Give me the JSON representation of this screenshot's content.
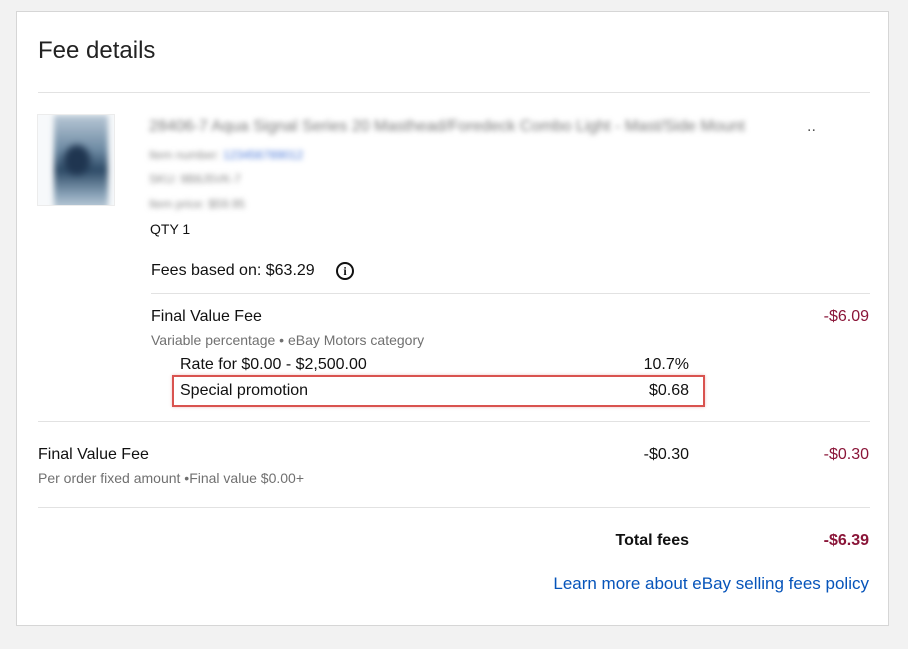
{
  "header": {
    "title": "Fee details"
  },
  "item": {
    "title_blurred": "28406-7 Aqua Signal Series 20 Masthead/Foredeck Combo Light - Mast/Side Mount",
    "ellipsis": "..",
    "item_number_label": "Item number:",
    "item_number_value": "123456789012",
    "sku_label": "SKU: 9B8J5VK-7",
    "price_label": "Item price: $59.95",
    "qty": "QTY 1"
  },
  "fees_based": {
    "text": "Fees based on: $63.29",
    "info_icon": "info-icon"
  },
  "final_value_fee_1": {
    "label": "Final Value Fee",
    "sub": "Variable percentage  •  eBay Motors category",
    "amount": "-$6.09",
    "rate_label": "Rate for $0.00 - $2,500.00",
    "rate_value": "10.7%",
    "promo_label": "Special promotion",
    "promo_value": "$0.68"
  },
  "final_value_fee_2": {
    "label": "Final Value Fee",
    "sub": "Per order fixed amount  •Final value $0.00+",
    "middle": "-$0.30",
    "amount": "-$0.30"
  },
  "total": {
    "label": "Total fees",
    "value": "-$6.39"
  },
  "link": {
    "text": "Learn more about eBay selling fees policy"
  },
  "colors": {
    "accent_red": "#8a1538",
    "link_blue": "#0654ba",
    "highlight_border": "#d9534f"
  }
}
